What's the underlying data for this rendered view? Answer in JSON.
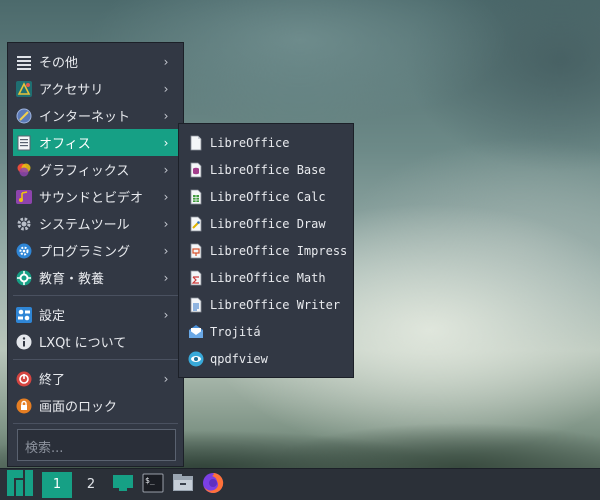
{
  "main_menu": {
    "items": [
      {
        "label": "その他",
        "icon": "list-icon"
      },
      {
        "label": "アクセサリ",
        "icon": "accessories-icon"
      },
      {
        "label": "インターネット",
        "icon": "globe-icon"
      },
      {
        "label": "オフィス",
        "icon": "office-icon"
      },
      {
        "label": "グラフィックス",
        "icon": "graphics-icon"
      },
      {
        "label": "サウンドとビデオ",
        "icon": "multimedia-icon"
      },
      {
        "label": "システムツール",
        "icon": "system-tools-icon"
      },
      {
        "label": "プログラミング",
        "icon": "programming-icon"
      },
      {
        "label": "教育・教養",
        "icon": "education-icon"
      }
    ],
    "settings": {
      "label": "設定",
      "icon": "settings-icon"
    },
    "about": {
      "label": "LXQt について",
      "icon": "info-icon"
    },
    "leave": {
      "label": "終了",
      "icon": "power-icon"
    },
    "lock": {
      "label": "画面のロック",
      "icon": "lock-icon"
    },
    "search_placeholder": "検索..."
  },
  "office_submenu": {
    "items": [
      {
        "label": "LibreOffice",
        "icon": "libreoffice-icon"
      },
      {
        "label": "LibreOffice Base",
        "icon": "libreoffice-base-icon"
      },
      {
        "label": "LibreOffice Calc",
        "icon": "libreoffice-calc-icon"
      },
      {
        "label": "LibreOffice Draw",
        "icon": "libreoffice-draw-icon"
      },
      {
        "label": "LibreOffice Impress",
        "icon": "libreoffice-impress-icon"
      },
      {
        "label": "LibreOffice Math",
        "icon": "libreoffice-math-icon"
      },
      {
        "label": "LibreOffice Writer",
        "icon": "libreoffice-writer-icon"
      },
      {
        "label": "Trojitá",
        "icon": "mail-icon"
      },
      {
        "label": "qpdfview",
        "icon": "eye-icon"
      }
    ]
  },
  "taskbar": {
    "workspaces": [
      "1",
      "2"
    ],
    "current_workspace": "1"
  },
  "colors": {
    "accent": "#16a085",
    "menu_bg": "#323844",
    "taskbar_bg": "#2b3038"
  }
}
